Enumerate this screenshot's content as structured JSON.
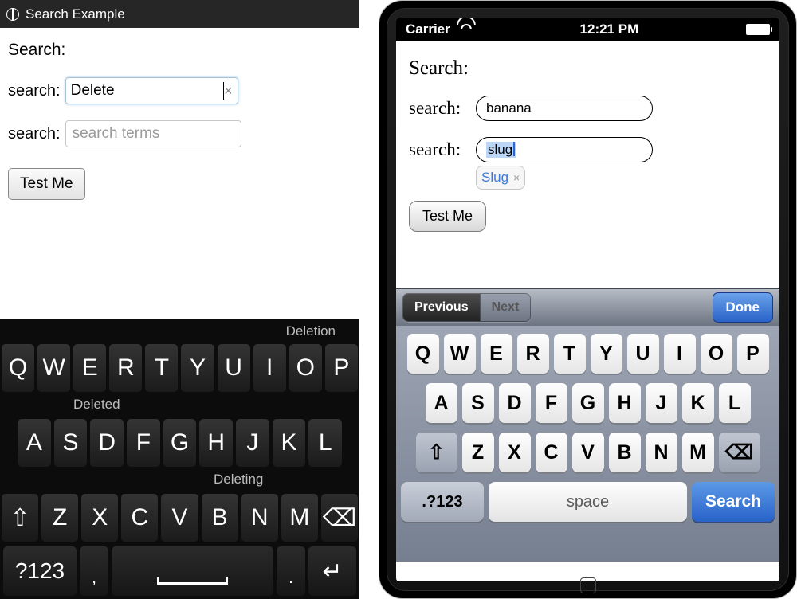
{
  "left": {
    "title": "Search Example",
    "header": "Search:",
    "row1_label": "search:",
    "row1_value": "Delete",
    "row1_clear": "×",
    "row2_label": "search:",
    "row2_placeholder": "search terms",
    "button": "Test Me",
    "suggestions": {
      "top": "Deletion",
      "mid": "Deleted",
      "low": "Deleting"
    },
    "keys": {
      "r1": [
        "Q",
        "W",
        "E",
        "R",
        "T",
        "Y",
        "U",
        "I",
        "O",
        "P"
      ],
      "r2": [
        "A",
        "S",
        "D",
        "F",
        "G",
        "H",
        "J",
        "K",
        "L"
      ],
      "r3": [
        "⇧",
        "Z",
        "X",
        "C",
        "V",
        "B",
        "N",
        "M",
        "⌫"
      ],
      "num": "?123",
      "comma": ",",
      "period": ".",
      "enter": "↵"
    }
  },
  "right": {
    "status": {
      "carrier": "Carrier",
      "time": "12:21 PM"
    },
    "header": "Search:",
    "row1_label": "search:",
    "row1_value": "banana",
    "row2_label": "search:",
    "row2_value": "slug",
    "suggestion": "Slug",
    "suggestion_x": "×",
    "button": "Test Me",
    "acc": {
      "prev": "Previous",
      "next": "Next",
      "done": "Done"
    },
    "kb": {
      "r1": [
        "Q",
        "W",
        "E",
        "R",
        "T",
        "Y",
        "U",
        "I",
        "O",
        "P"
      ],
      "r2": [
        "A",
        "S",
        "D",
        "F",
        "G",
        "H",
        "J",
        "K",
        "L"
      ],
      "r3": [
        "⇧",
        "Z",
        "X",
        "C",
        "V",
        "B",
        "N",
        "M",
        "⌫"
      ],
      "num": ".?123",
      "space": "space",
      "search": "Search"
    }
  }
}
